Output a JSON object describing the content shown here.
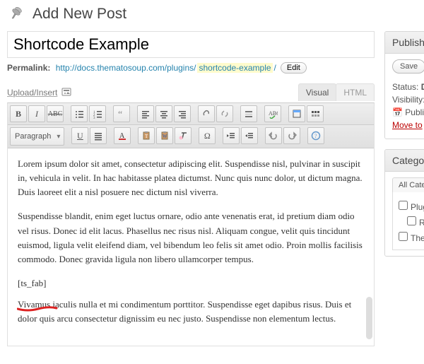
{
  "header": {
    "title": "Add New Post"
  },
  "post": {
    "title": "Shortcode Example",
    "permalink_label": "Permalink:",
    "permalink_base": "http://docs.thematosoup.com/plugins/",
    "slug": "shortcode-example",
    "slug_trail": "/",
    "edit_label": "Edit"
  },
  "media": {
    "label": "Upload/Insert"
  },
  "tabs": {
    "visual": "Visual",
    "html": "HTML"
  },
  "toolbar": {
    "format": "Paragraph"
  },
  "content": {
    "p1": "Lorem ipsum dolor sit amet, consectetur adipiscing elit. Suspendisse nisl, pulvinar in suscipit in, vehicula in velit. In hac habitasse platea dictumst. Nunc quis nunc dolor, ut dictum magna. Duis laoreet elit a nisl posuere nec dictum nisl viverra.",
    "p2": "Suspendisse blandit, enim eget luctus ornare, odio ante venenatis erat, id pretium diam odio vel risus. Donec id elit lacus. Phasellus nec risus nisl. Aliquam congue, velit quis tincidunt euismod, ligula velit eleifend diam, vel bibendum leo felis sit amet odio. Proin mollis facilisis commodo. Donec gravida ligula non libero ullamcorper tempus.",
    "shortcode": "[ts_fab]",
    "p3": "Vivamus iaculis nulla et mi condimentum porttitor. Suspendisse eget dapibus risus. Duis et dolor quis arcu consectetur dignissim eu nec justo. Suspendisse non elementum lectus."
  },
  "sidebar": {
    "publish": {
      "title": "Publish",
      "save_draft": "Save",
      "status_label": "Status:",
      "status_value": "D",
      "visibility_label": "Visibility:",
      "publish_label": "Publish",
      "trash": "Move to"
    },
    "categories": {
      "title": "Categor",
      "all_tab": "All Cate",
      "items": [
        "Plug",
        "R",
        "The"
      ]
    }
  }
}
